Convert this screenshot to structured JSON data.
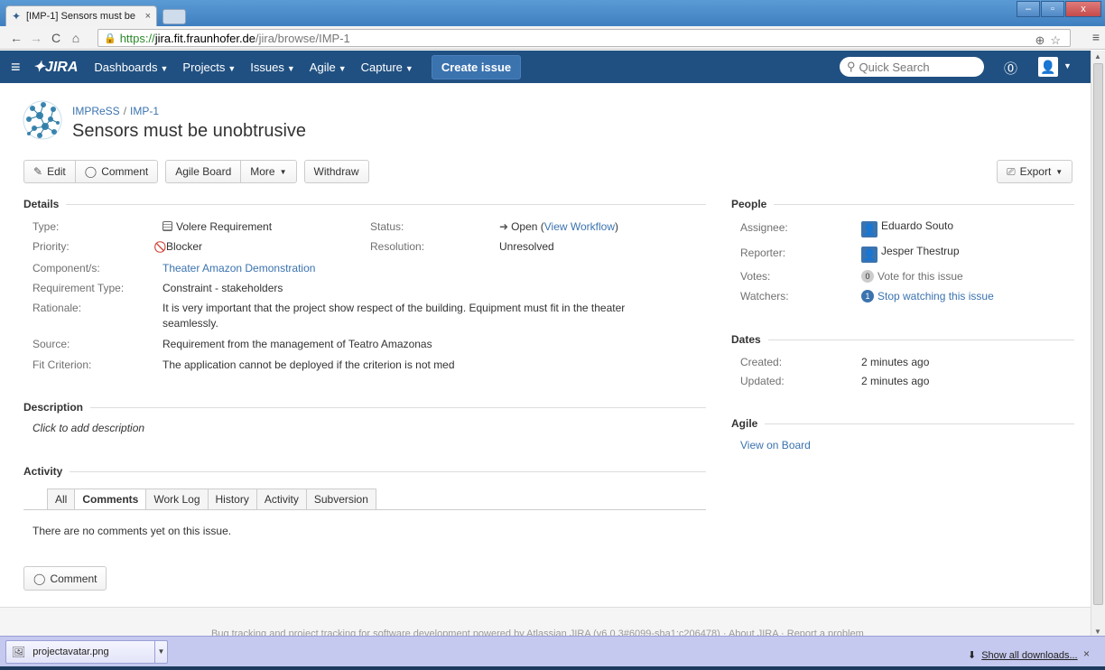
{
  "browser": {
    "tab_title": "[IMP-1] Sensors must be",
    "tab_close": "×",
    "url_https": "https://",
    "url_host": "jira.fit.fraunhofer.de",
    "url_path": "/jira/browse/IMP-1",
    "win_min": "–",
    "win_max": "▫",
    "win_close": "x"
  },
  "header": {
    "logo": "JIRA",
    "nav": [
      "Dashboards",
      "Projects",
      "Issues",
      "Agile",
      "Capture"
    ],
    "create_label": "Create issue",
    "search_placeholder": "Quick Search"
  },
  "issue": {
    "project": "IMPReSS",
    "key": "IMP-1",
    "title": "Sensors must be unobtrusive"
  },
  "actions": {
    "edit": "Edit",
    "comment": "Comment",
    "agile_board": "Agile Board",
    "more": "More",
    "withdraw": "Withdraw",
    "export": "Export"
  },
  "details": {
    "heading": "Details",
    "type_label": "Type:",
    "type_value": "Volere Requirement",
    "status_label": "Status:",
    "status_value": "Open",
    "view_workflow": "View Workflow",
    "priority_label": "Priority:",
    "priority_value": "Blocker",
    "resolution_label": "Resolution:",
    "resolution_value": "Unresolved",
    "component_label": "Component/s:",
    "component_value": "Theater Amazon Demonstration",
    "reqtype_label": "Requirement Type:",
    "reqtype_value": "Constraint - stakeholders",
    "rationale_label": "Rationale:",
    "rationale_line1": "It is very important that the project show respect of the building. Equipment must fit in the theater",
    "rationale_line2": "seamlessly.",
    "source_label": "Source:",
    "source_value": "Requirement from the management of Teatro Amazonas",
    "fit_label": "Fit Criterion:",
    "fit_value": "The application cannot be deployed if the criterion is not med"
  },
  "description": {
    "heading": "Description",
    "placeholder": "Click to add description"
  },
  "activity": {
    "heading": "Activity",
    "tabs": [
      "All",
      "Comments",
      "Work Log",
      "History",
      "Activity",
      "Subversion"
    ],
    "empty_text": "There are no comments yet on this issue.",
    "comment_button": "Comment"
  },
  "people": {
    "heading": "People",
    "assignee_label": "Assignee:",
    "assignee_value": "Eduardo Souto",
    "reporter_label": "Reporter:",
    "reporter_value": "Jesper Thestrup",
    "votes_label": "Votes:",
    "votes_count": "0",
    "votes_text": "Vote for this issue",
    "watchers_label": "Watchers:",
    "watchers_count": "1",
    "watchers_text": "Stop watching this issue"
  },
  "dates": {
    "heading": "Dates",
    "created_label": "Created:",
    "created_value": "2 minutes ago",
    "updated_label": "Updated:",
    "updated_value": "2 minutes ago"
  },
  "agile": {
    "heading": "Agile",
    "view_on_board": "View on Board"
  },
  "footer": {
    "text": "Bug tracking and project tracking for software development powered by Atlassian JIRA (v6.0.3#6099-sha1:c206478)  ·  About JIRA  ·  Report a problem"
  },
  "downloads": {
    "file_name": "projectavatar.png",
    "show_all": "Show all downloads...",
    "close": "×"
  }
}
